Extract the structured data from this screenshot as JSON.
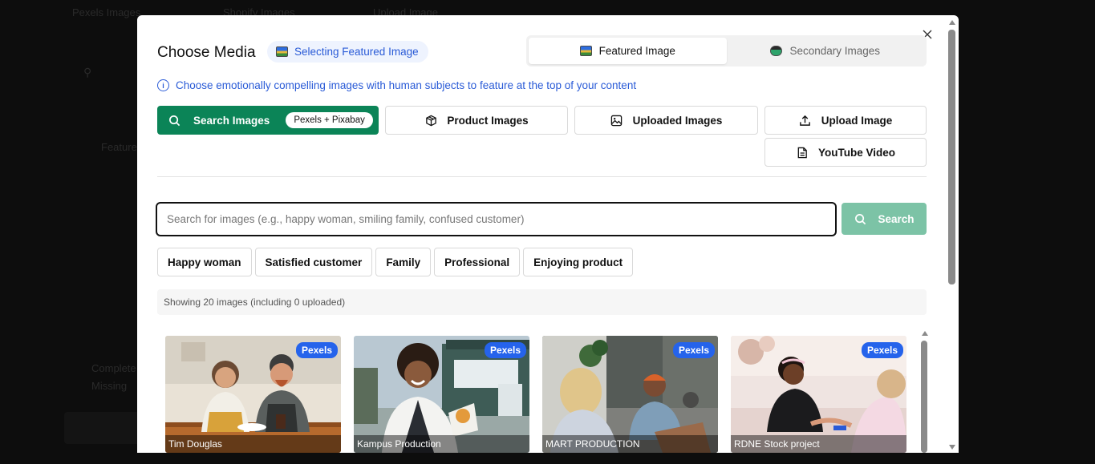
{
  "background": {
    "labels": [
      "Pexels Images",
      "Shopify Images",
      "Upload Image",
      "Featured",
      "Complete",
      "Missing"
    ]
  },
  "modal": {
    "title": "Choose Media",
    "selecting_badge": "Selecting Featured Image",
    "close_icon": "close-icon",
    "tabs": [
      {
        "label": "Featured Image",
        "active": true,
        "icon": "photo-icon"
      },
      {
        "label": "Secondary Images",
        "active": false,
        "icon": "photo-icon"
      }
    ],
    "info_text": "Choose emotionally compelling images with human subjects to feature at the top of your content",
    "sources": {
      "search_images": {
        "label": "Search Images",
        "pill": "Pexels + Pixabay",
        "icon": "search-icon"
      },
      "product_images": {
        "label": "Product Images",
        "icon": "box-icon"
      },
      "uploaded_images": {
        "label": "Uploaded Images",
        "icon": "image-icon"
      },
      "upload_image": {
        "label": "Upload Image",
        "icon": "upload-icon"
      },
      "youtube_video": {
        "label": "YouTube Video",
        "icon": "document-icon"
      }
    },
    "search": {
      "placeholder": "Search for images (e.g., happy woman, smiling family, confused customer)",
      "value": "",
      "button_label": "Search"
    },
    "chips": [
      "Happy woman",
      "Satisfied customer",
      "Family",
      "Professional",
      "Enjoying product"
    ],
    "showing_text": "Showing 20 images (including 0 uploaded)",
    "images": [
      {
        "source": "Pexels",
        "credit": "Tim Douglas"
      },
      {
        "source": "Pexels",
        "credit": "Kampus Production"
      },
      {
        "source": "Pexels",
        "credit": "MART PRODUCTION"
      },
      {
        "source": "Pexels",
        "credit": "RDNE Stock project"
      }
    ],
    "colors": {
      "primary_green": "#0b8457",
      "search_button": "#7cc3a6",
      "accent_blue": "#2a5bd7",
      "pexels_badge": "#2563eb"
    }
  }
}
